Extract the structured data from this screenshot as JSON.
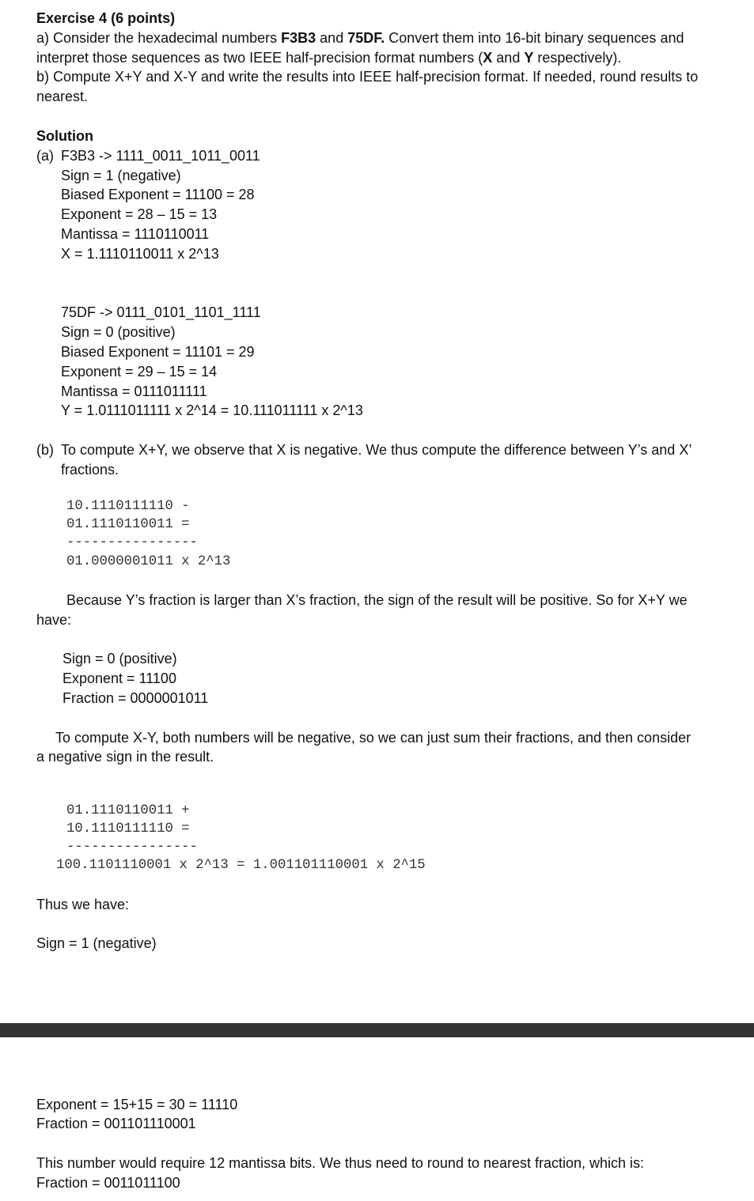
{
  "header": {
    "title": "Exercise 4 (6 points)",
    "a_part1": "a) Consider the hexadecimal numbers ",
    "a_hex1": "F3B3",
    "a_and": " and ",
    "a_hex2": "75DF.",
    "a_part2": " Convert them into 16-bit binary sequences and",
    "a_line2_pre": "interpret those sequences as two IEEE half-precision format numbers (",
    "a_X": "X",
    "a_and2": " and ",
    "a_Y": "Y",
    "a_line2_post": " respectively).",
    "b_line1": "b) Compute X+Y and X-Y and write the results into IEEE half-precision format. If needed, round results to",
    "b_line2": "nearest."
  },
  "solution": {
    "title": "Solution",
    "a_label": "(a)",
    "x_lines": [
      "F3B3 -> 1111_0011_1011_0011",
      "Sign = 1 (negative)",
      "Biased Exponent = 11100 = 28",
      "Exponent = 28 – 15 = 13",
      "Mantissa = 1110110011",
      "X = 1.1110110011 x 2^13"
    ],
    "y_lines": [
      "75DF -> 0111_0101_1101_1111",
      "Sign = 0 (positive)",
      "Biased Exponent = 11101 = 29",
      "Exponent = 29 – 15 = 14",
      "Mantissa = 0111011111",
      "Y = 1.0111011111 x 2^14 = 10.111011111 x 2^13"
    ],
    "b_label": "(b)",
    "b_line1": "To compute X+Y, we observe that X is negative. We thus compute the difference between Y’s and X’",
    "b_line2": "fractions.",
    "sub_calc": [
      "10.1110111110 -",
      "01.1110110011 =",
      "----------------",
      "01.0000001011 x 2^13"
    ],
    "because_line1": "Because Y’s fraction is larger than X’s fraction, the sign of the result will be positive. So for X+Y we",
    "because_line2": "have:",
    "sum_result": [
      "Sign = 0 (positive)",
      "Exponent = 11100",
      "Fraction = 0000001011"
    ],
    "xy_line1": "To compute X-Y, both numbers will be negative, so we can just sum their fractions, and then consider",
    "xy_line2": "a negative sign in the result.",
    "add_calc": [
      "01.1110110011 +",
      "10.1110111110 =",
      "----------------",
      "100.1101110001 x 2^13 = 1.001101110001 x 2^15"
    ],
    "thus": "Thus we have:",
    "sign_neg": "Sign = 1 (negative)",
    "after_divider": [
      "Exponent = 15+15 = 30 = 11110",
      "Fraction = 001101110001"
    ],
    "round_line1": "This number would require 12 mantissa bits. We thus need to round to nearest fraction, which is:",
    "round_line2": "Fraction = 0011011100"
  }
}
